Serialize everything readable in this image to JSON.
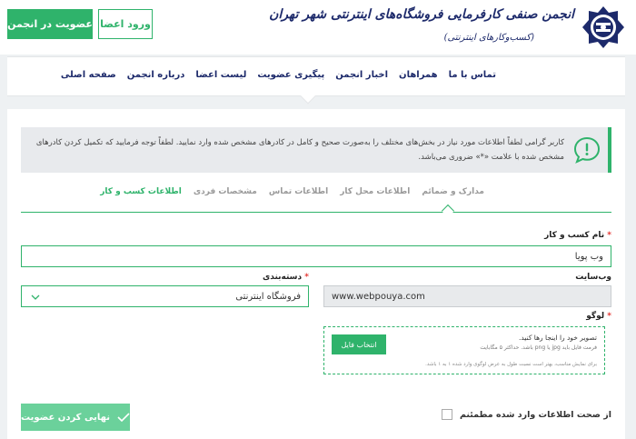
{
  "header": {
    "join_button": "عضویت در انجمن",
    "login_button": "ورود اعضا",
    "logo_title": "انجمن صنفی کارفرمایی فروشگاه‌های اینترنتی شهر تهران",
    "logo_subtitle": "(کسب‌وکارهای اینترنتی)"
  },
  "nav": {
    "items": [
      "صفحه اصلی",
      "درباره انجمن",
      "لیست اعضا",
      "پیگیری عضویت",
      "اخبار انجمن",
      "همراهان",
      "تماس با ما"
    ]
  },
  "notice": {
    "text": "کاربر گرامی لطفاً اطلاعات مورد نیاز در بخش‌های مختلف را به‌صورت صحیح و کامل در کادرهای مشخص شده وارد نمایید. لطفاً توجه فرمایید که تکمیل کردن کادرهای مشخص شده با علامت «*» ضروری می‌باشد."
  },
  "tabs": [
    "اطلاعات کسب و کار",
    "مشخصات فردی",
    "اطلاعات تماس",
    "اطلاعات محل کار",
    "مدارک و ضمائم"
  ],
  "form": {
    "business_name_label": "نام کسب و کار",
    "business_name_value": "وب پویا",
    "website_label": "وب‌سایت",
    "website_value": "www.webpouya.com",
    "category_label": "دسته‌بندی",
    "category_value": "فروشگاه اینترنتی",
    "logo_label": "لوگو",
    "required_mark": "*",
    "dropzone_main": "تصویر خود را اینجا رها کنید.",
    "dropzone_sub": "فرمت فایل باید jpg یا png باشد. حداکثر ۵ مگابایت",
    "dropzone_note": "برای نمایش مناسب، بهتر است نسبت طول به عرض لوگوی وارد شده ۱ به ۱ باشد.",
    "choose_file_button": "انتخاب فایل"
  },
  "footer": {
    "finish_button": "نهایی کردن عضویت",
    "confirm_label": "از صحت اطلاعات وارد شده مطمئنم"
  },
  "colors": {
    "accent": "#2fb36b",
    "accent_light": "#6bd19b",
    "brand_navy": "#1d2a6b",
    "required": "#e53935"
  }
}
